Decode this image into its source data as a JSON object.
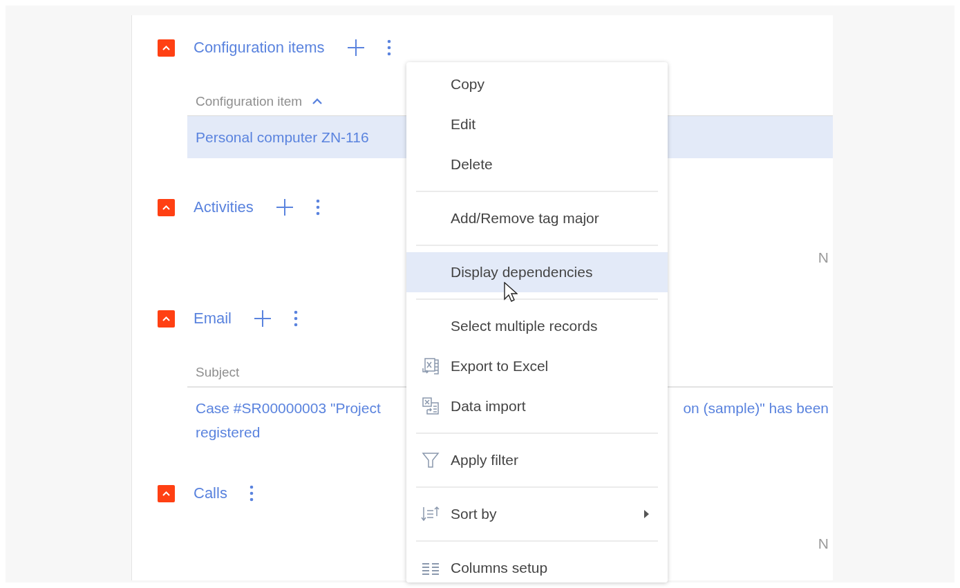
{
  "sections": [
    {
      "kind": "table",
      "title": "Configuration items",
      "expanded": true,
      "add_button": true,
      "table": {
        "columns": [
          {
            "label": "Configuration item",
            "sorted_ascending": true
          }
        ],
        "rows": [
          {
            "parts": [
              "Personal computer ZN-116"
            ],
            "selected": true
          }
        ]
      }
    },
    {
      "kind": "empty",
      "title": "Activities",
      "expanded": true,
      "add_button": true,
      "empty_text": "N"
    },
    {
      "kind": "table",
      "title": "Email",
      "expanded": true,
      "add_button": true,
      "table": {
        "columns": [
          {
            "label": "Subject",
            "sorted_ascending": false
          }
        ],
        "rows": [
          {
            "parts": [
              "Case #SR00000003 \"Project",
              "on (sample)\" has been",
              "registered"
            ],
            "selected": false
          }
        ]
      }
    },
    {
      "kind": "empty",
      "title": "Calls",
      "expanded": true,
      "add_button": false,
      "empty_text": "N"
    }
  ],
  "context_menu": {
    "items": [
      {
        "kind": "plain",
        "label": "Copy",
        "highlighted": false
      },
      {
        "kind": "plain",
        "label": "Edit",
        "highlighted": false
      },
      {
        "kind": "plain",
        "label": "Delete",
        "highlighted": false
      },
      {
        "kind": "divider"
      },
      {
        "kind": "plain",
        "label": "Add/Remove tag major",
        "highlighted": false
      },
      {
        "kind": "divider"
      },
      {
        "kind": "plain",
        "label": "Display dependencies",
        "highlighted": true
      },
      {
        "kind": "divider"
      },
      {
        "kind": "plain",
        "label": "Select multiple records",
        "highlighted": false
      },
      {
        "kind": "export",
        "label": "Export to Excel",
        "highlighted": false
      },
      {
        "kind": "import",
        "label": "Data import",
        "highlighted": false
      },
      {
        "kind": "divider"
      },
      {
        "kind": "filter",
        "label": "Apply filter",
        "highlighted": false
      },
      {
        "kind": "divider"
      },
      {
        "kind": "sort",
        "label": "Sort by",
        "highlighted": false,
        "submenu": true
      },
      {
        "kind": "divider"
      },
      {
        "kind": "columns",
        "label": "Columns setup",
        "highlighted": false
      }
    ]
  }
}
